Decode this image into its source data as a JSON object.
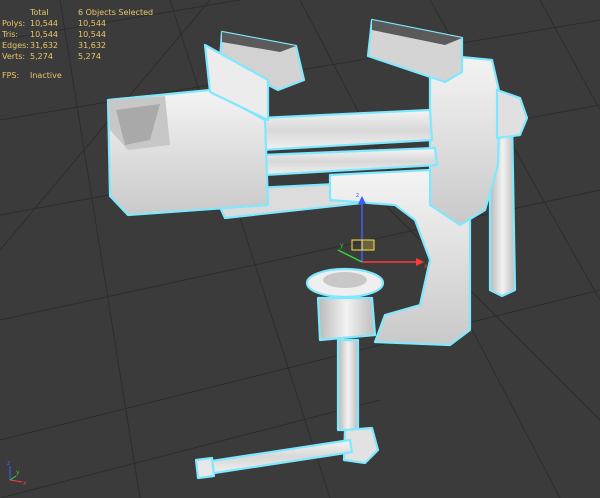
{
  "stats": {
    "header": {
      "total": "Total",
      "selected": "6 Objects Selected"
    },
    "rows": [
      {
        "label": "Polys:",
        "total": "10,544",
        "selected": "10,544"
      },
      {
        "label": "Tris:",
        "total": "10,544",
        "selected": "10,544"
      },
      {
        "label": "Edges:",
        "total": "31,632",
        "selected": "31,632"
      },
      {
        "label": "Verts:",
        "total": "5,274",
        "selected": "5,274"
      }
    ],
    "fps": {
      "label": "FPS:",
      "value": "Inactive"
    }
  },
  "viewport": {
    "background": "#3b3b3b",
    "grid_color": "#2e2e2e",
    "selection_outline": "#7fe8ff",
    "model_color": "#e4e4e4"
  },
  "gizmo": {
    "x_label": "x",
    "y_label": "y",
    "z_label": "z"
  }
}
